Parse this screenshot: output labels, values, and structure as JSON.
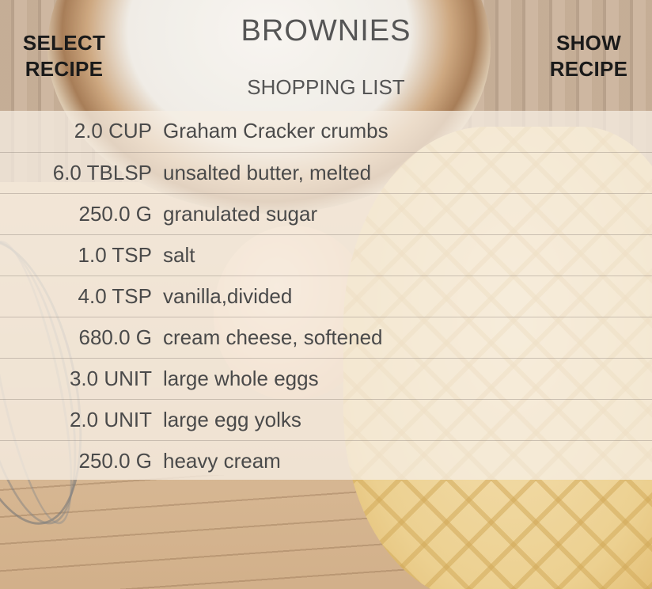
{
  "header": {
    "select_label_line1": "SELECT",
    "select_label_line2": "RECIPE",
    "show_label_line1": "SHOW",
    "show_label_line2": "RECIPE",
    "title": "BROWNIES",
    "subtitle": "SHOPPING LIST"
  },
  "ingredients": [
    {
      "qty": "2.0 CUP",
      "name": "Graham Cracker crumbs"
    },
    {
      "qty": "6.0 TBLSP",
      "name": "unsalted butter, melted"
    },
    {
      "qty": "250.0 G",
      "name": "granulated sugar"
    },
    {
      "qty": "1.0 TSP",
      "name": "salt"
    },
    {
      "qty": "4.0 TSP",
      "name": "vanilla,divided"
    },
    {
      "qty": "680.0 G",
      "name": "cream cheese, softened"
    },
    {
      "qty": "3.0 UNIT",
      "name": "large whole eggs"
    },
    {
      "qty": "2.0 UNIT",
      "name": "large egg yolks"
    },
    {
      "qty": "250.0 G",
      "name": "heavy cream"
    }
  ]
}
